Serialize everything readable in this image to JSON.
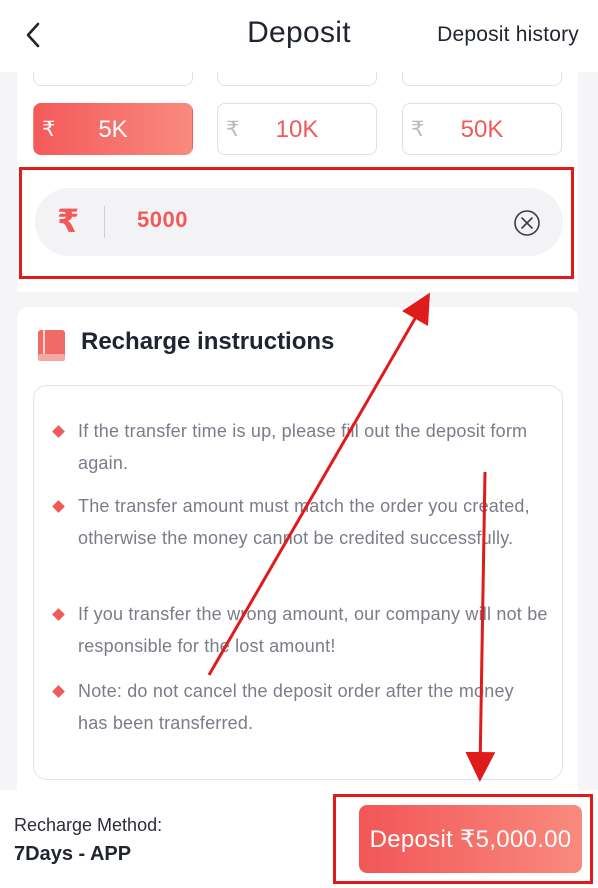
{
  "header": {
    "title": "Deposit",
    "history_label": "Deposit history"
  },
  "amounts": {
    "currency_symbol": "₹",
    "chips": [
      {
        "label": "5K",
        "selected": true
      },
      {
        "label": "10K",
        "selected": false
      },
      {
        "label": "50K",
        "selected": false
      }
    ],
    "input_value": "5000"
  },
  "instructions": {
    "title": "Recharge instructions",
    "items": [
      "If the transfer time is up, please fill out the deposit form again.",
      "The transfer amount must match the order you created, otherwise the money cannot be credited successfully.",
      "If you transfer the wrong amount, our company will not be responsible for the lost amount!",
      "Note: do not cancel the deposit order after the money has been transferred."
    ]
  },
  "footer": {
    "method_label": "Recharge Method:",
    "method_value": "7Days - APP",
    "deposit_button": "Deposit ₹5,000.00"
  },
  "colors": {
    "accent": "#f05a5a",
    "annotation": "#e01b1b"
  }
}
